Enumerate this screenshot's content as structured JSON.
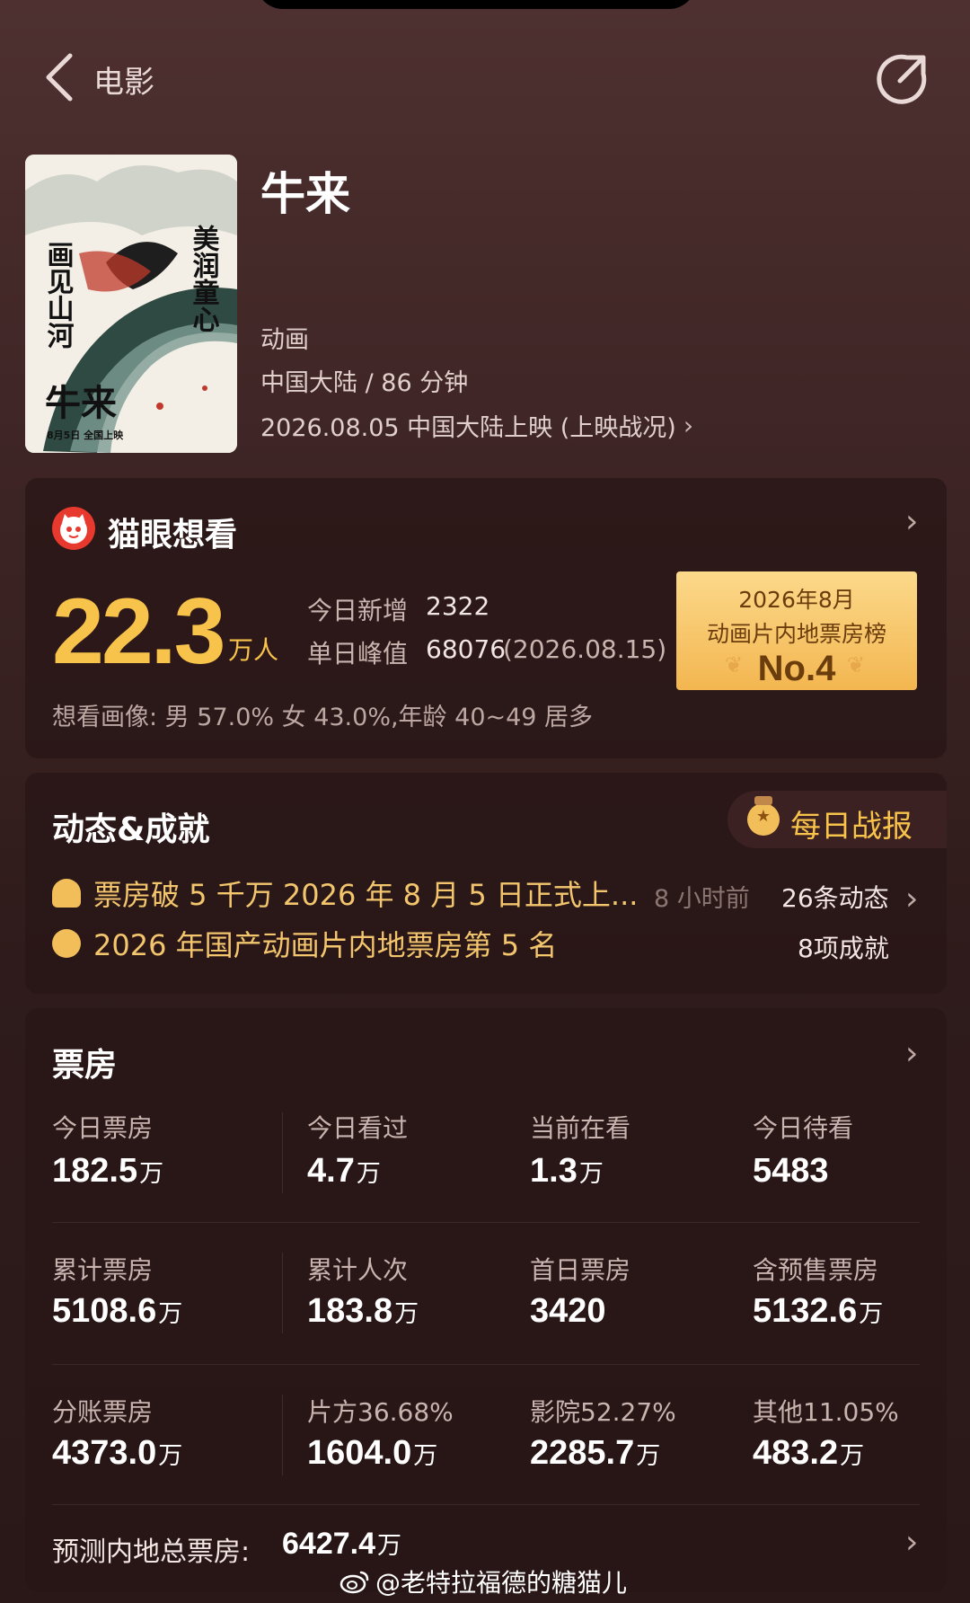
{
  "topbar": {
    "back_label": "电影"
  },
  "movie": {
    "title": "牛来",
    "genre": "动画",
    "region_duration": "中国大陆 / 86 分钟",
    "release": "2026.08.05 中国大陆上映 (上映战况)",
    "poster": {
      "left_text": "画见山河",
      "right_text": "美润童心",
      "title_text": "牛来",
      "date_text": "8月5日 全国上映"
    }
  },
  "want": {
    "title": "猫眼想看",
    "number": "22.3",
    "unit": "万人",
    "today_label": "今日新增",
    "today_value": "2322",
    "peak_label": "单日峰值",
    "peak_value": "68076",
    "peak_date": "(2026.08.15)",
    "portrait": "想看画像: 男 57.0%  女 43.0%,年龄 40~49 居多",
    "rank": {
      "line1": "2026年8月",
      "line2": "动画片内地票房榜",
      "line3": "No.4"
    }
  },
  "news": {
    "title": "动态&成就",
    "daily_label": "每日战报",
    "row1_text": "票房破 5 千万 2026 年 8 月 5 日正式上...",
    "row1_time": "8 小时前",
    "row1_count": "26条动态",
    "row2_text": "2026 年国产动画片内地票房第 5 名",
    "row2_count": "8项成就"
  },
  "boxoffice": {
    "title": "票房",
    "rows": [
      [
        {
          "label": "今日票房",
          "value": "182.5",
          "unit": "万"
        },
        {
          "label": "今日看过",
          "value": "4.7",
          "unit": "万"
        },
        {
          "label": "当前在看",
          "value": "1.3",
          "unit": "万"
        },
        {
          "label": "今日待看",
          "value": "5483",
          "unit": ""
        }
      ],
      [
        {
          "label": "累计票房",
          "value": "5108.6",
          "unit": "万"
        },
        {
          "label": "累计人次",
          "value": "183.8",
          "unit": "万"
        },
        {
          "label": "首日票房",
          "value": "3420",
          "unit": ""
        },
        {
          "label": "含预售票房",
          "value": "5132.6",
          "unit": "万"
        }
      ],
      [
        {
          "label": "分账票房",
          "value": "4373.0",
          "unit": "万"
        },
        {
          "label": "片方36.68%",
          "value": "1604.0",
          "unit": "万"
        },
        {
          "label": "影院52.27%",
          "value": "2285.7",
          "unit": "万"
        },
        {
          "label": "其他11.05%",
          "value": "483.2",
          "unit": "万"
        }
      ]
    ],
    "forecast_label": "预测内地总票房:",
    "forecast_value": "6427.4",
    "forecast_unit": "万"
  },
  "watermark": "@老特拉福德的糖猫儿"
}
